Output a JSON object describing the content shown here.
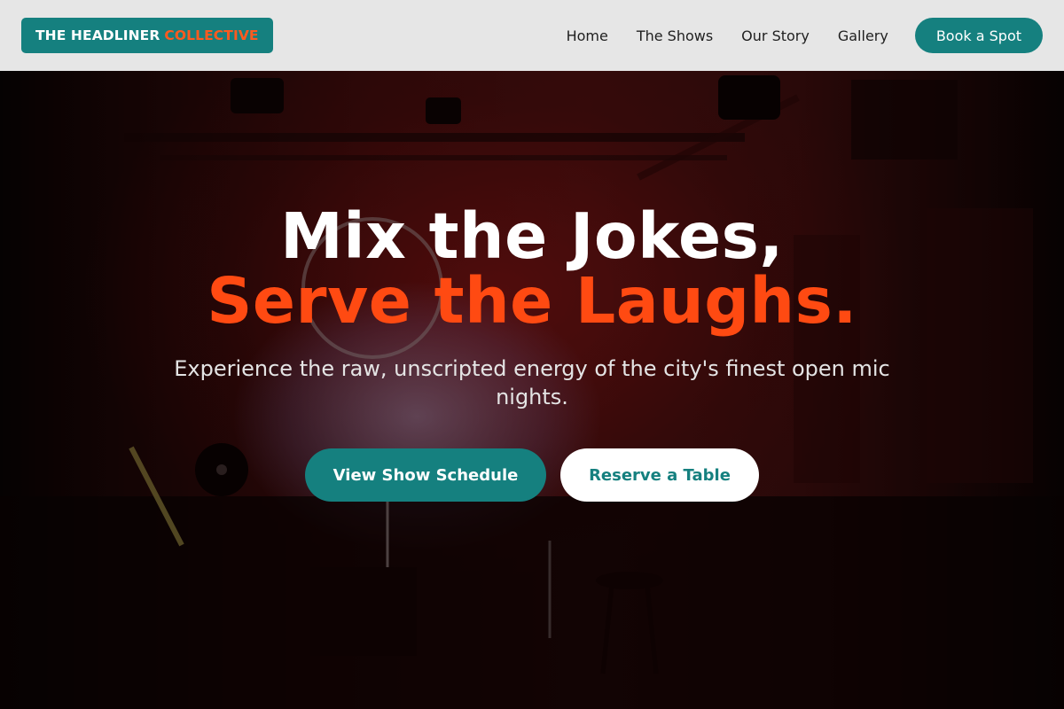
{
  "header": {
    "logo_main": "THE HEADLINER",
    "logo_accent": "COLLECTIVE",
    "nav": [
      {
        "label": "Home"
      },
      {
        "label": "The Shows"
      },
      {
        "label": "Our Story"
      },
      {
        "label": "Gallery"
      }
    ],
    "cta_label": "Book a Spot"
  },
  "hero": {
    "headline_line1": "Mix the Jokes,",
    "headline_line2": "Serve the Laughs.",
    "subtext": "Experience the raw, unscripted energy of the city's finest open mic nights.",
    "primary_button": "View Show Schedule",
    "secondary_button": "Reserve a Table",
    "background_image": "comedy-club-stage-photo"
  },
  "colors": {
    "teal": "#15807f",
    "orange_accent": "#ff4a12",
    "header_bg": "#e6e6e6",
    "white": "#ffffff"
  }
}
